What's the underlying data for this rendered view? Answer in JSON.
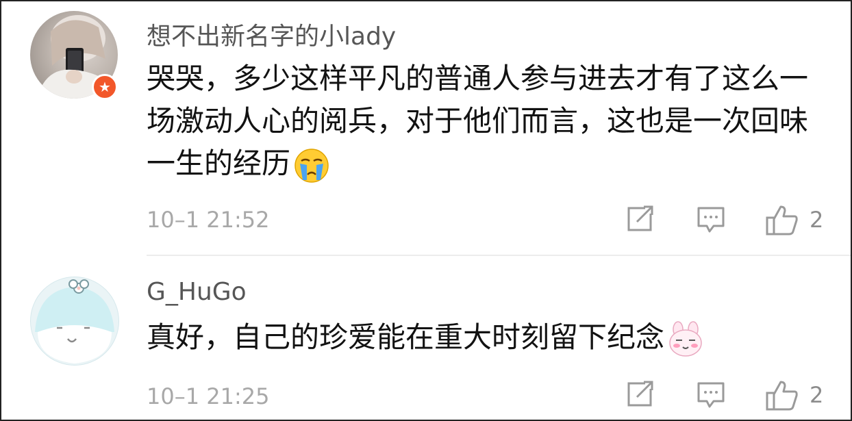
{
  "comments": [
    {
      "username": "想不出新名字的小lady",
      "text": "哭哭，多少这样平凡的普通人参与进去才有了这么一场激动人心的阅兵，对于他们而言，这也是一次回味一生的经历",
      "emoji": "crying-face-emoji",
      "badge_icon": "star-badge-icon",
      "time": "10–1 21:52",
      "likes": "2"
    },
    {
      "username": "G_HuGo",
      "text": "真好，自己的珍爱能在重大时刻留下纪念",
      "emoji": "bunny-face-emoji",
      "time": "10–1 21:25",
      "likes": "2"
    }
  ],
  "colors": {
    "username": "#565656",
    "text": "#121212",
    "meta": "#a8a8a8",
    "badge": "#f2572a",
    "divider": "#ececec"
  }
}
